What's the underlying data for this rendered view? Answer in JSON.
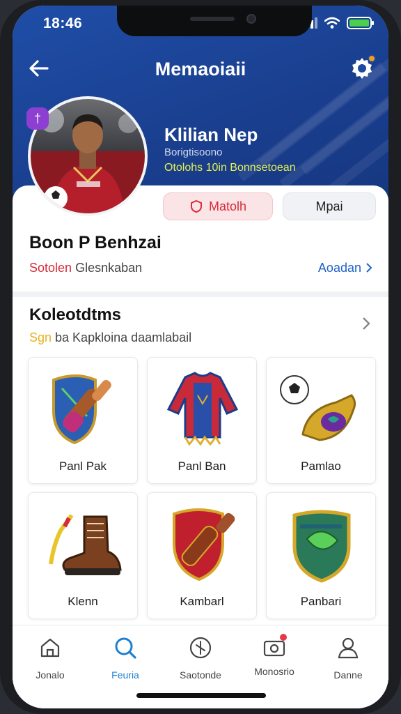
{
  "status": {
    "time": "18:46"
  },
  "header": {
    "title": "Memaoiaii"
  },
  "profile": {
    "name": "Klilian Nep",
    "subtitle": "Borigtisoono",
    "stat": "Otolohs 10in Bonnsetoean",
    "badge_icon": "tag-icon",
    "match_label": "Matolh",
    "mpai_label": "Mpai"
  },
  "section1": {
    "title": "Boon P Benhzai",
    "row_red": "Sotolen",
    "row_text": " Glesnkaban",
    "link": "Aoadan"
  },
  "collections": {
    "title": "Koleotdtms",
    "sub_gold": "Sgn",
    "sub_text": " ba Kapkloina daamlabail",
    "items": [
      {
        "label": "Panl Pak",
        "icon": "shield-telescope-icon"
      },
      {
        "label": "Panl Ban",
        "icon": "jersey-icon"
      },
      {
        "label": "Pamlao",
        "icon": "ball-horn-icon"
      },
      {
        "label": "Klenn",
        "icon": "boot-icon"
      },
      {
        "label": "Kambarl",
        "icon": "red-shield-scroll-icon"
      },
      {
        "label": "Panbari",
        "icon": "green-shield-icon"
      }
    ]
  },
  "tabs": [
    {
      "label": "Jonalo",
      "icon": "home-icon"
    },
    {
      "label": "Feuria",
      "icon": "search-icon",
      "active": true
    },
    {
      "label": "Saotonde",
      "icon": "compass-icon"
    },
    {
      "label": "Monosrio",
      "icon": "camera-icon"
    },
    {
      "label": "Danne",
      "icon": "profile-icon"
    }
  ],
  "colors": {
    "header": "#1f4ea8",
    "accent_red": "#d62b3a",
    "accent_blue": "#1f7fd0"
  }
}
